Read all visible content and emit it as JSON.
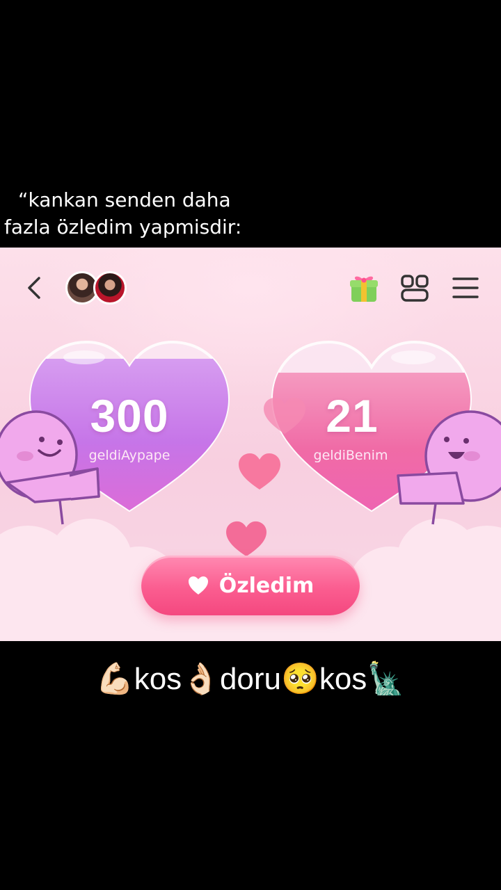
{
  "caption_top": {
    "line1": "“kankan senden daha",
    "line2": "fazla özledim yapmisdir:"
  },
  "header": {
    "back_icon": "chevron-left-icon",
    "gift_icon": "gift-icon",
    "grid_icon": "widgets-icon",
    "menu_icon": "hamburger-menu-icon"
  },
  "hearts": {
    "left": {
      "count": "300",
      "label": "geldiAypape",
      "color": "#c77dec"
    },
    "right": {
      "count": "21",
      "label": "geldiBenim",
      "color": "#f06ba6"
    }
  },
  "button": {
    "label": "Özledim",
    "icon": "heart-icon"
  },
  "caption_bottom": "💪🏻kos👌🏻doru🥺kos🗽",
  "colors": {
    "background": "#f9d2e2",
    "button": "#fb5d90",
    "character": "#f0a8ea"
  }
}
